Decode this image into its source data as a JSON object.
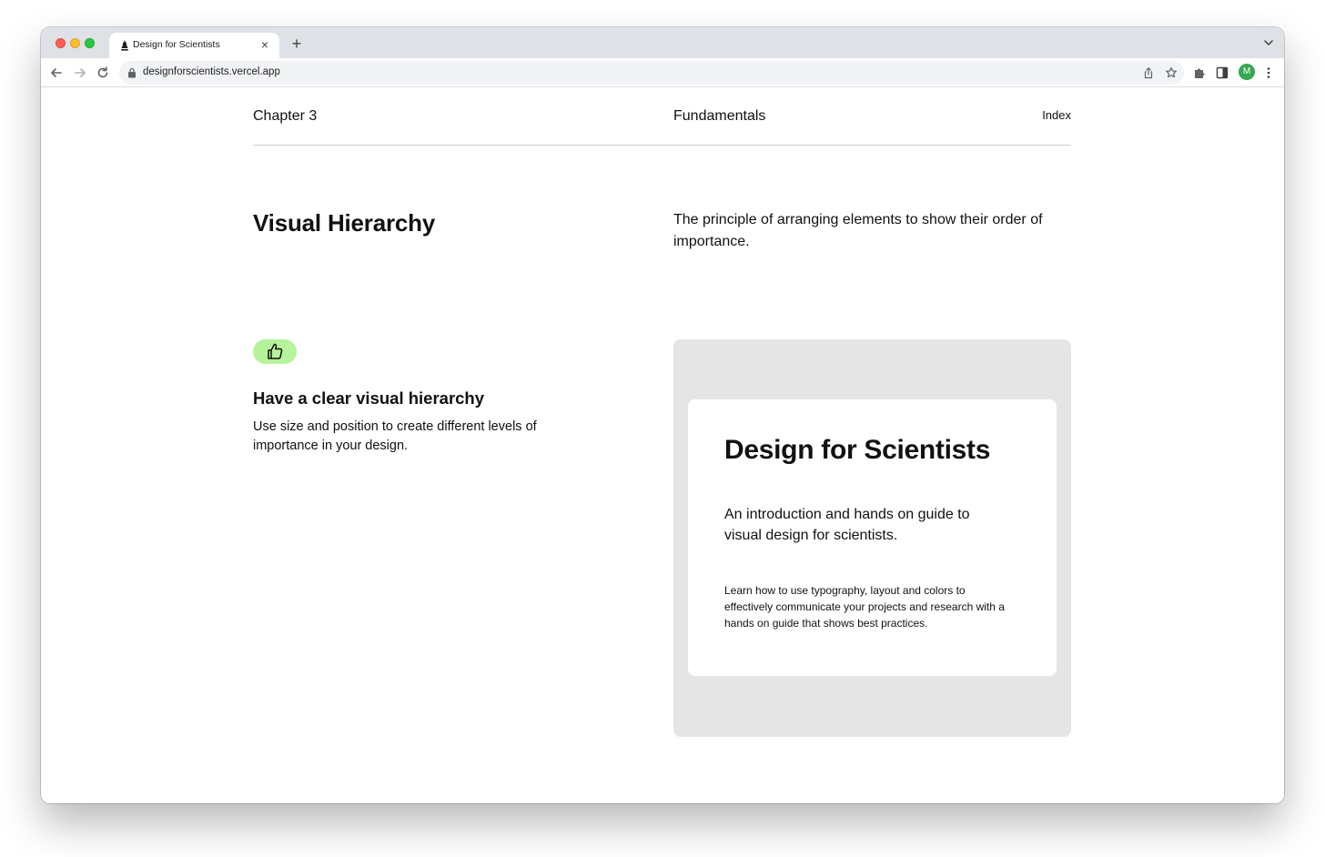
{
  "browser": {
    "tab": {
      "title": "Design for Scientists",
      "close_glyph": "×",
      "favicon": "vercel-avatar-icon"
    },
    "new_tab_glyph": "+",
    "url": "designforscientists.vercel.app",
    "avatar_initial": "M",
    "avatar_color": "#34a853",
    "icons": [
      "back-icon",
      "forward-icon",
      "reload-icon",
      "lock-icon",
      "share-icon",
      "star-icon",
      "extensions-icon",
      "sidepanel-icon",
      "menu-icon",
      "tab-search-icon"
    ]
  },
  "header": {
    "chapter": "Chapter 3",
    "section": "Fundamentals",
    "index_link": "Index"
  },
  "main": {
    "title": "Visual Hierarchy",
    "intro": "The principle of arranging elements to show their order of importance.",
    "tip": {
      "badge_icon": "thumbs-up-icon",
      "badge_color": "#b7f39a",
      "title": "Have a clear visual hierarchy",
      "body": "Use size and position to create different levels of importance in your design."
    },
    "example": {
      "panel_color": "#e5e5e5",
      "title": "Design for Scientists",
      "subtitle": "An introduction and hands on guide to visual design for scientists.",
      "body": "Learn how to use typography, layout and colors to effectively communicate your projects and research with a hands on guide that shows best practices."
    }
  }
}
